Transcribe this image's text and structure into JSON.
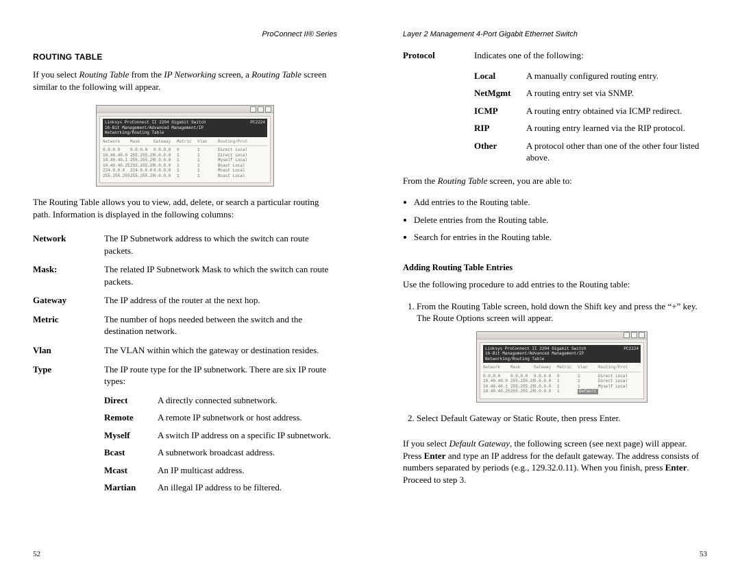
{
  "left": {
    "running_head": "ProConnect II® Series",
    "section_title": "ROUTING TABLE",
    "intro_1a": "If you select ",
    "intro_1b": "Routing Table",
    "intro_1c": " from the ",
    "intro_1d": "IP Networking",
    "intro_1e": " screen, a ",
    "intro_1f": "Routing Table",
    "intro_1g": " screen similar to the following will appear.",
    "after_shot": "The Routing Table allows you to view, add, delete, or search a particular routing path. Information is displayed in the following columns:",
    "cols": [
      {
        "t": "Network",
        "d": "The IP Subnetwork address to which the switch can route packets."
      },
      {
        "t": "Mask:",
        "d": "The related IP Subnetwork Mask to which the switch can route packets."
      },
      {
        "t": "Gateway",
        "d": "The IP address of the router at the next hop."
      },
      {
        "t": "Metric",
        "d": "The number of hops needed between the switch and the destination network."
      },
      {
        "t": "Vlan",
        "d": "The VLAN within which the gateway or destination resides."
      },
      {
        "t": "Type",
        "d": "The IP route type for the IP subnetwork. There are six IP route types:"
      }
    ],
    "type_sub": [
      {
        "t": "Direct",
        "d": "A directly connected subnetwork."
      },
      {
        "t": "Remote",
        "d": "A remote IP subnetwork or host address."
      },
      {
        "t": "Myself",
        "d": "A switch IP address on a specific IP subnetwork."
      },
      {
        "t": "Bcast",
        "d": "A subnetwork broadcast address."
      },
      {
        "t": "Mcast",
        "d": "An IP multicast address."
      },
      {
        "t": "Martian",
        "d": "An illegal IP address to be filtered."
      }
    ],
    "page_num": "52"
  },
  "right": {
    "running_head": "Layer 2 Management 4-Port Gigabit Ethernet Switch",
    "protocol_label": "Protocol",
    "protocol_desc": "Indicates one of the following:",
    "protocol_sub": [
      {
        "t": "Local",
        "d": "A manually configured routing entry."
      },
      {
        "t": "NetMgmt",
        "d": "A routing entry set via SNMP."
      },
      {
        "t": "ICMP",
        "d": "A routing entry obtained via ICMP redirect."
      },
      {
        "t": "RIP",
        "d": "A routing entry learned via the RIP protocol."
      },
      {
        "t": "Other",
        "d": "A protocol other than one of the other four listed above."
      }
    ],
    "from_rt_a": "From the ",
    "from_rt_b": "Routing Table",
    "from_rt_c": " screen, you are able to:",
    "bullets": [
      "Add entries to the Routing table.",
      "Delete entries from the Routing table.",
      "Search for entries in the Routing table."
    ],
    "adding_hdr": "Adding Routing Table Entries",
    "adding_intro": "Use the following procedure to add entries to the Routing table:",
    "step1_a": "From the ",
    "step1_b": "Routing Table",
    "step1_c": " screen, hold down the ",
    "step1_d": "Shift",
    "step1_e": " key and press the “",
    "step1_f": "+",
    "step1_g": "” key. The ",
    "step1_h": "Route Options",
    "step1_i": " screen will appear.",
    "step2_a": "Select ",
    "step2_b": "Default Gateway",
    "step2_c": " or ",
    "step2_d": "Static Route",
    "step2_e": ", then press ",
    "step2_f": "Enter",
    "step2_g": ".",
    "tail_a": "If you select ",
    "tail_b": "Default Gateway",
    "tail_c": ", the following screen (see next page) will appear. Press ",
    "tail_d": "Enter",
    "tail_e": " and type an IP address for the default gateway. The address consists of numbers separated by periods (e.g., 129.32.0.11). When you finish, press ",
    "tail_f": "Enter",
    "tail_g": ". Proceed to step 3.",
    "page_num": "53"
  },
  "shot": {
    "bar_left": "Linksys ProConnect II 2204 Gigabit Switch\n16-Bit Management/Advanced Management/IP Networking/Routing Table",
    "bar_right": "PC2224",
    "cols": [
      "Network",
      "Mask",
      "Gateway",
      "Metric",
      "Vlan",
      "Routing/Prot"
    ],
    "rows": [
      [
        "0.0.0.0",
        "0.0.0.0",
        "0.0.0.0",
        "0",
        "1",
        "Direct Local"
      ],
      [
        "10.40.40.0",
        "255.255.255.0",
        "0.0.0.0",
        "1",
        "1",
        "Direct Local"
      ],
      [
        "10.40.40.1",
        "255.255.255.255",
        "0.0.0.0",
        "1",
        "1",
        "Myself Local"
      ],
      [
        "10.40.40.255",
        "255.255.255.255",
        "0.0.0.0",
        "1",
        "1",
        "Bcast Local"
      ],
      [
        "224.0.0.0",
        "224.0.0.0",
        "0.0.0.0",
        "1",
        "1",
        "Mcast Local"
      ],
      [
        "255.255.255.255",
        "255.255.255.255",
        "0.0.0.0",
        "1",
        "1",
        "Bcast Local"
      ]
    ]
  }
}
